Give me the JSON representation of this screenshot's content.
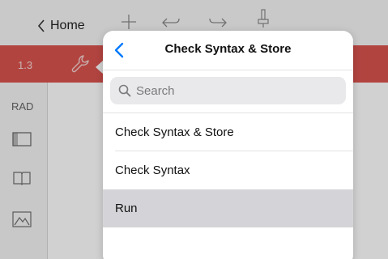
{
  "toolbar": {
    "home_label": "Home",
    "icons": [
      "back-chevron-icon",
      "plus-icon",
      "undo-icon",
      "redo-icon",
      "pin-icon"
    ]
  },
  "tabbar": {
    "page_number": "1.3",
    "tool_icon": "wrench-icon",
    "accent_color": "#d9534f"
  },
  "sidebar": {
    "mode_label": "RAD",
    "icons": [
      "layout-icon",
      "book-icon",
      "graph-icon"
    ]
  },
  "popover": {
    "title": "Check Syntax & Store",
    "back_icon": "back-chevron-icon",
    "search": {
      "placeholder": "Search",
      "value": ""
    },
    "items": [
      {
        "label": "Check Syntax & Store",
        "selected": false
      },
      {
        "label": "Check Syntax",
        "selected": false
      },
      {
        "label": "Run",
        "selected": true
      }
    ],
    "accent_color": "#007aff"
  }
}
